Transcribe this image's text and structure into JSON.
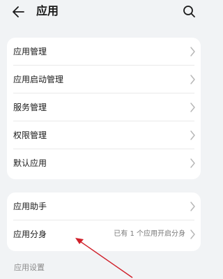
{
  "header": {
    "title": "应用",
    "back_icon": "arrow-left-icon",
    "search_icon": "search-icon"
  },
  "card1": {
    "items": [
      {
        "label": "应用管理"
      },
      {
        "label": "应用启动管理"
      },
      {
        "label": "服务管理"
      },
      {
        "label": "权限管理"
      },
      {
        "label": "默认应用"
      }
    ]
  },
  "card2": {
    "items": [
      {
        "label": "应用助手"
      },
      {
        "label": "应用分身",
        "value": "已有 1 个应用开启分身"
      }
    ]
  },
  "section": {
    "label": "应用设置"
  },
  "colors": {
    "background": "#f1f3f5",
    "card": "#ffffff",
    "annotation_arrow": "#d0202a"
  }
}
